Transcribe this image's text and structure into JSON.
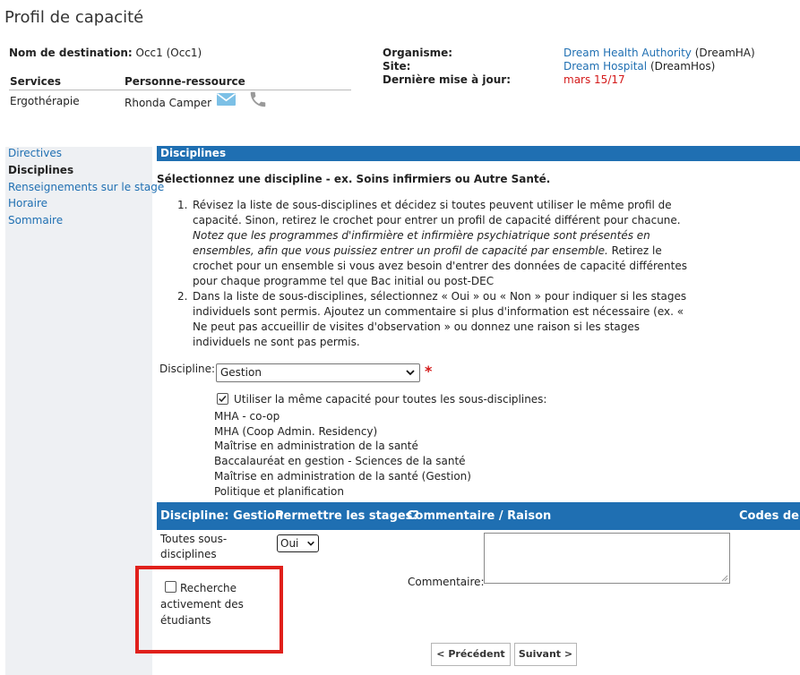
{
  "page": {
    "title": "Profil de capacité"
  },
  "destination": {
    "label": "Nom de destination:",
    "value": "Occ1 (Occ1)"
  },
  "services_table": {
    "headers": [
      "Services",
      "Personne-ressource"
    ],
    "row": {
      "service": "Ergothérapie",
      "contact": "Rhonda Camper"
    }
  },
  "org_info": {
    "organization_label": "Organisme:",
    "organization_link": "Dream Health Authority",
    "organization_suffix": "(DreamHA)",
    "site_label": "Site:",
    "site_link": "Dream Hospital",
    "site_suffix": "(DreamHos)",
    "updated_label": "Dernière mise à jour:",
    "updated_value": "mars 15/17"
  },
  "nav": {
    "items": [
      {
        "label": "Directives",
        "active": false
      },
      {
        "label": "Disciplines",
        "active": true
      },
      {
        "label": "Renseignements sur le stage",
        "active": false
      },
      {
        "label": "Horaire",
        "active": false
      },
      {
        "label": "Sommaire",
        "active": false
      }
    ]
  },
  "section": {
    "bar_title": "Disciplines",
    "subtitle": "Sélectionnez une discipline - ex. Soins infirmiers ou Autre Santé.",
    "instructions": [
      {
        "number": "1.",
        "text_a": "Révisez la liste de sous-disciplines et décidez si toutes peuvent utiliser le même profil de capacité. Sinon, retirez le crochet pour entrer un profil de capacité différent pour chacune.",
        "text_italic": "Notez que les programmes d'infirmière et infirmière psychiatrique sont présentés en ensembles, afin que vous puissiez entrer un profil de capacité par ensemble.",
        "text_b": "Retirez le crochet pour un ensemble si vous avez besoin d'entrer des données de capacité différentes pour chaque programme tel que Bac initial ou post-DEC"
      },
      {
        "number": "2.",
        "text_a": "Dans la liste de sous-disciplines, sélectionnez « Oui » ou « Non » pour indiquer si les stages individuels sont permis. Ajoutez un commentaire si plus d'information est nécessaire (ex. « Ne peut pas accueillir de visites d'observation » ou donnez une raison si les stages individuels ne sont pas permis.",
        "text_italic": "",
        "text_b": ""
      }
    ]
  },
  "form": {
    "discipline_label": "Discipline:",
    "discipline_value": "Gestion",
    "required_marker": "*",
    "same_capacity_label": "Utiliser la même capacité pour toutes les sous-disciplines:",
    "same_capacity_checked": true,
    "subdisciplines": [
      "MHA - co-op",
      "MHA (Coop Admin. Residency)",
      "Maîtrise en administration de la santé",
      "Baccalauréat en gestion - Sciences de la santé",
      "Maîtrise en administration de la santé (Gestion)",
      "Politique et planification"
    ]
  },
  "grid": {
    "headers": [
      "Discipline: Gestion",
      "Permettre les stages?",
      "Commentaire / Raison",
      "Codes de d"
    ],
    "row_label": "Toutes sous-disciplines",
    "allow_value": "Oui",
    "comment_label": "Commentaire:",
    "comment_value": "",
    "recruiting_label": "Recherche activement des étudiants",
    "recruiting_checked": false
  },
  "buttons": {
    "previous": "< Précédent",
    "next": "Suivant >"
  },
  "colors": {
    "accent": "#1f6fb2",
    "highlight_frame": "#e0201b",
    "date": "#d41a1a"
  }
}
